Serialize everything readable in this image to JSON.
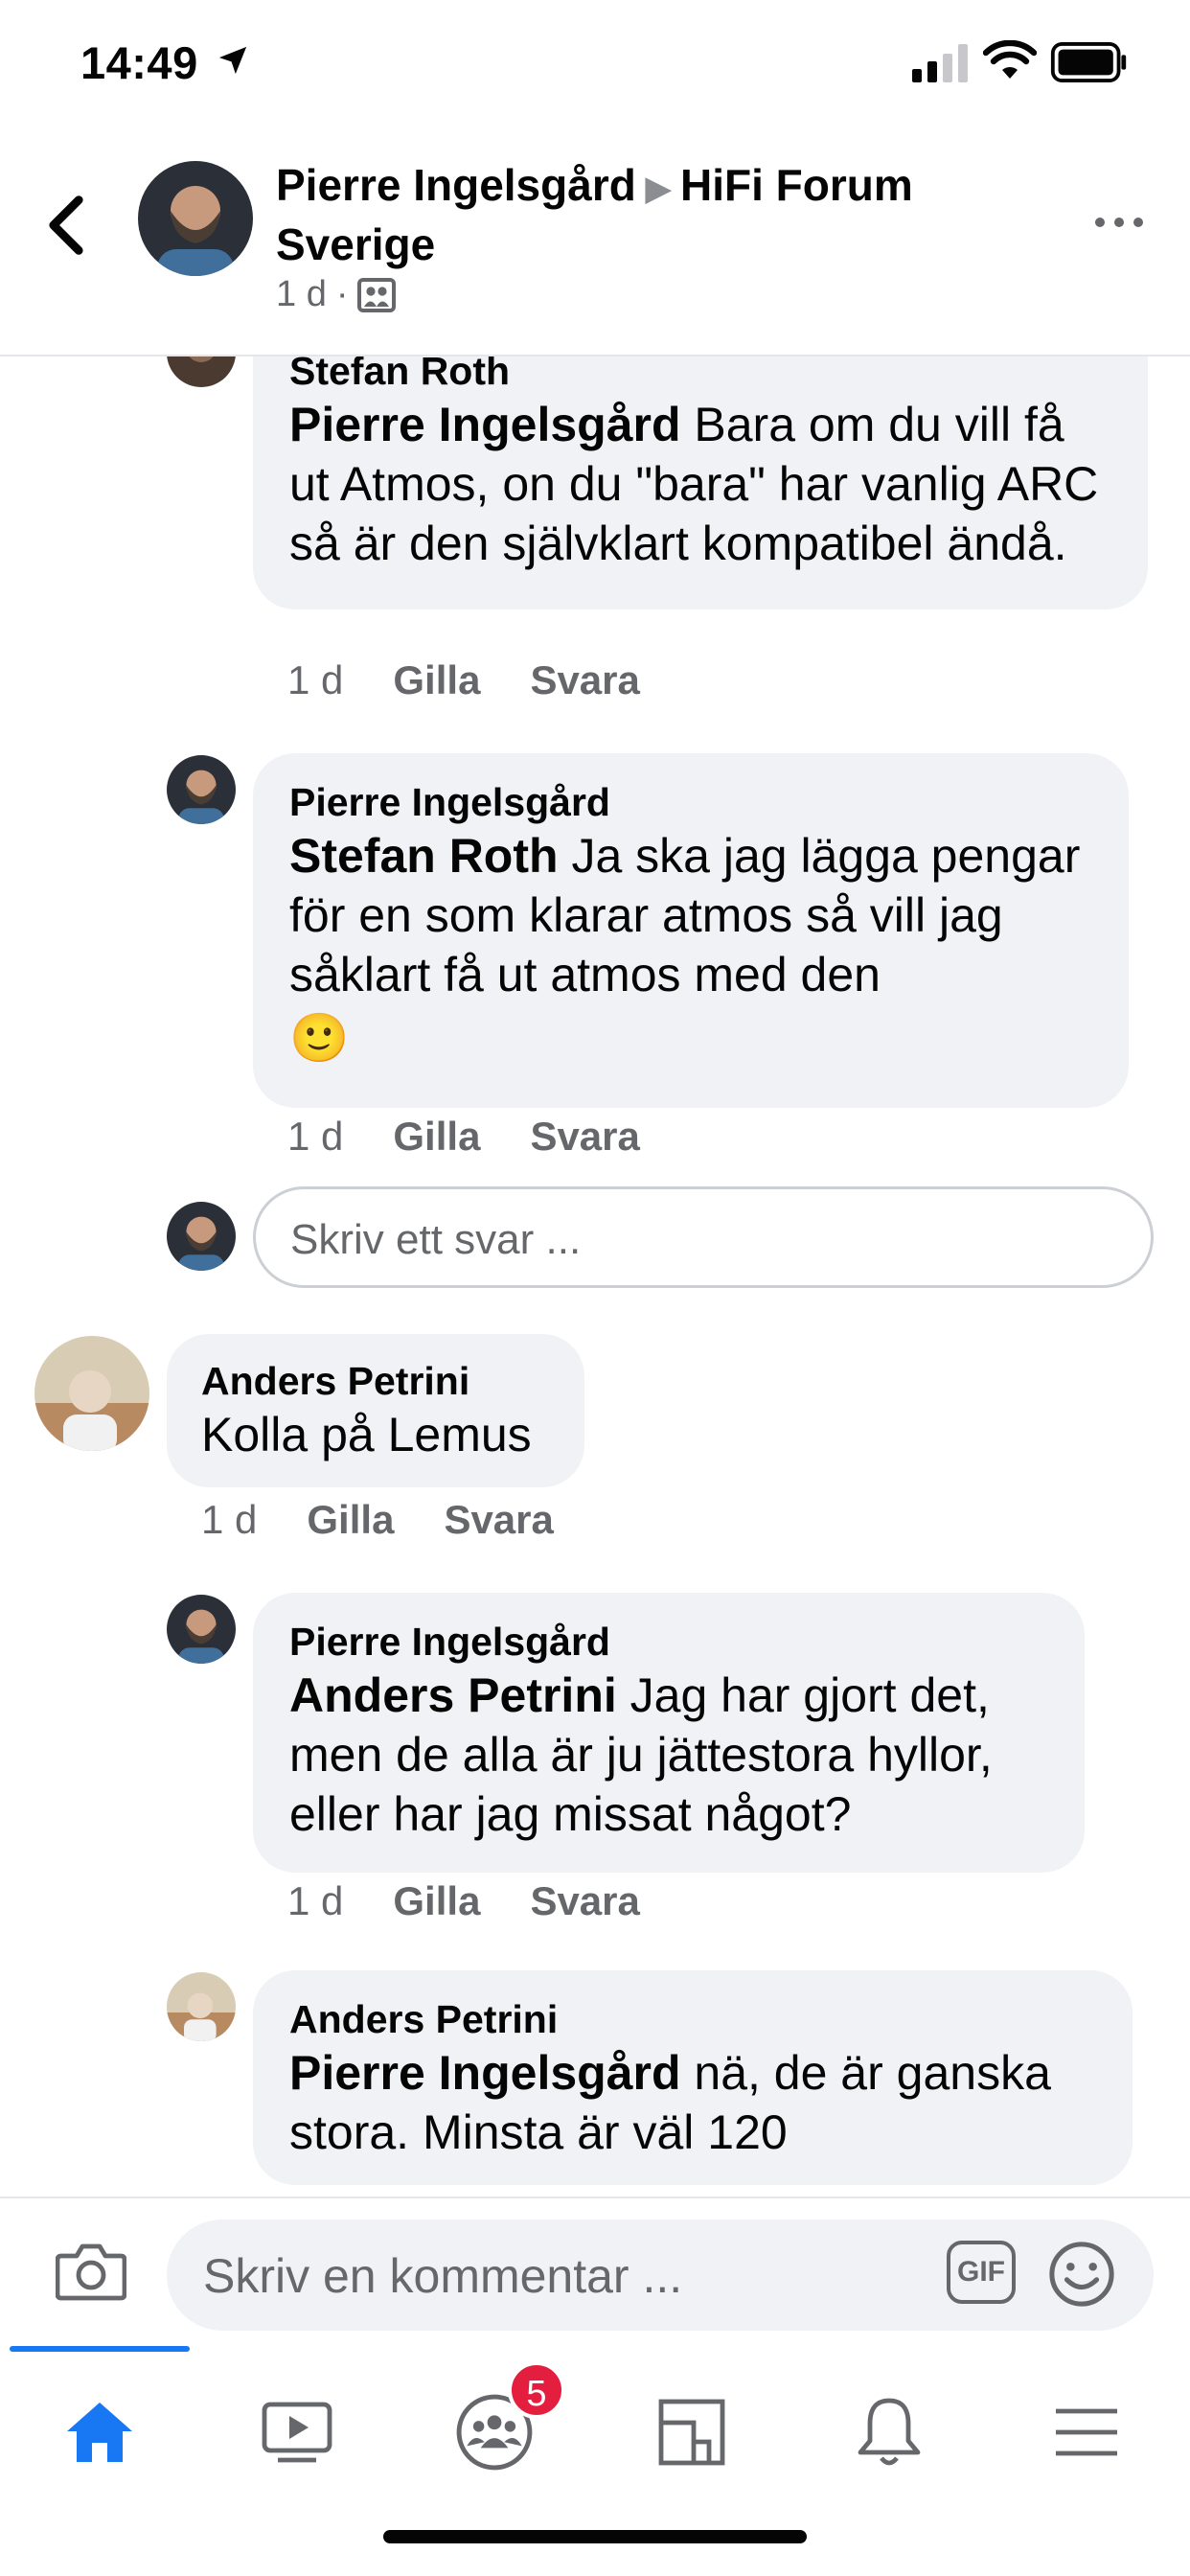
{
  "status_bar": {
    "time": "14:49"
  },
  "header": {
    "author": "Pierre Ingelsgård",
    "group": "HiFi Forum Sverige",
    "meta_time": "1 d",
    "separator": "·"
  },
  "comments": [
    {
      "author": "Stefan Roth",
      "mention": "Pierre Ingelsgård",
      "text": " Bara om du vill få ut Atmos, on du \"bara\" har vanlig ARC så är den självklart kompatibel ändå.",
      "time": "1 d",
      "like": "Gilla",
      "reply": "Svara"
    },
    {
      "author": "Pierre Ingelsgård",
      "mention": "Stefan Roth",
      "text": " Ja ska jag lägga pengar för en som klarar atmos så vill jag såklart få ut atmos med den",
      "emoji": "🙂",
      "time": "1 d",
      "like": "Gilla",
      "reply": "Svara"
    },
    {
      "author": "Anders Petrini",
      "text": "Kolla på Lemus",
      "time": "1 d",
      "like": "Gilla",
      "reply": "Svara"
    },
    {
      "author": "Pierre Ingelsgård",
      "mention": "Anders Petrini",
      "text": " Jag har gjort det, men de alla är ju jättestora hyllor, eller har jag missat något?",
      "time": "1 d",
      "like": "Gilla",
      "reply": "Svara"
    },
    {
      "author": "Anders Petrini",
      "mention": "Pierre Ingelsgård",
      "text": " nä, de är ganska stora. Minsta är väl 120"
    }
  ],
  "reply_placeholder": "Skriv ett svar ...",
  "composer": {
    "placeholder": "Skriv en kommentar ...",
    "gif_label": "GIF"
  },
  "tabbar": {
    "groups_badge": "5",
    "items": [
      "home-icon",
      "watch-icon",
      "groups-icon",
      "pages-icon",
      "notifications-icon",
      "menu-icon"
    ]
  },
  "colors": {
    "accent": "#1877f2",
    "bubble": "#f0f2f5",
    "muted": "#65676b",
    "badge": "#e41e3f"
  }
}
